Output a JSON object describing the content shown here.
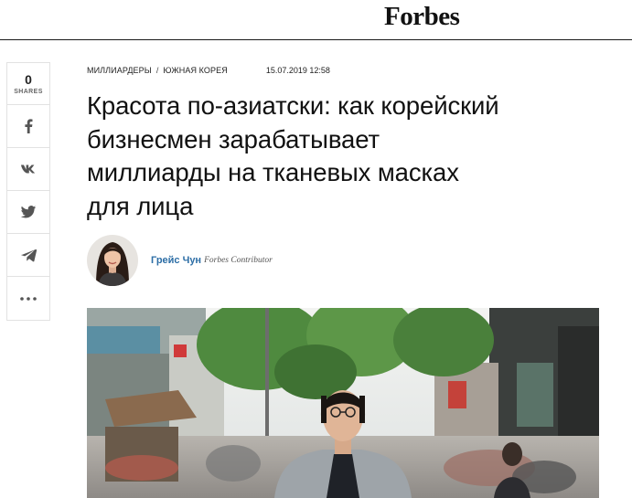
{
  "header": {
    "logo": "Forbes"
  },
  "share": {
    "count": "0",
    "label": "SHARES",
    "buttons": [
      {
        "icon": "facebook-icon"
      },
      {
        "icon": "vk-icon"
      },
      {
        "icon": "twitter-icon"
      },
      {
        "icon": "telegram-icon"
      },
      {
        "icon": "more-icon"
      }
    ]
  },
  "article": {
    "breadcrumbs": [
      "Миллиардеры",
      "Южная Корея"
    ],
    "breadcrumb_separator": "/",
    "date": "15.07.2019 12:58",
    "title": "Красота по-азиатски: как корейский бизнесмен зарабатывает миллиарды на тканевых масках для лица",
    "author": {
      "name": "Грейс Чун",
      "role": "Forbes Contributor"
    }
  },
  "colors": {
    "author_link": "#2d6ea6",
    "divider": "#1a1a1a",
    "rail_border": "#e2e2e2"
  }
}
